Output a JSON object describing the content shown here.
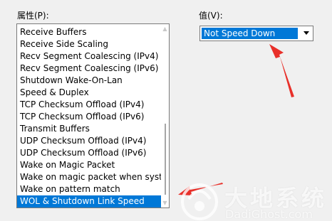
{
  "property_label": "属性(P):",
  "value_label": "值(V):",
  "properties": [
    "Receive Buffers",
    "Receive Side Scaling",
    "Recv Segment Coalescing (IPv4)",
    "Recv Segment Coalescing (IPv6)",
    "Shutdown Wake-On-Lan",
    "Speed & Duplex",
    "TCP Checksum Offload (IPv4)",
    "TCP Checksum Offload (IPv6)",
    "Transmit Buffers",
    "UDP Checksum Offload (IPv4)",
    "UDP Checksum Offload (IPv6)",
    "Wake on Magic Packet",
    "Wake on magic packet when syst",
    "Wake on pattern match",
    "WOL & Shutdown Link Speed"
  ],
  "selected_index": 14,
  "value_selected": "Not Speed Down",
  "watermark": {
    "title": "大地系统",
    "subtitle": "DadiGhost.com"
  },
  "colors": {
    "selection": "#0078d7",
    "annotation_arrow": "#e8302a"
  },
  "icons": {
    "dropdown": "chevron-down-icon"
  }
}
